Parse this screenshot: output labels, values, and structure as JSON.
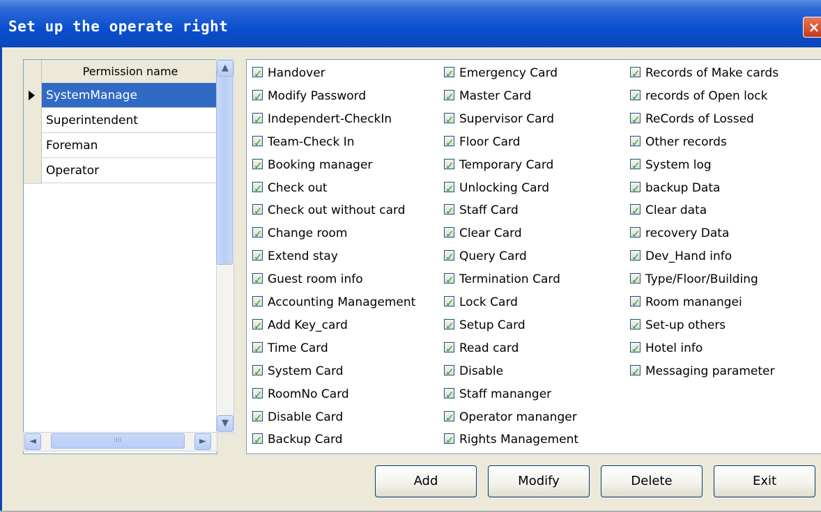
{
  "window": {
    "title": "Set up the operate right",
    "close_label": "×"
  },
  "grid": {
    "header": "Permission name",
    "rows": [
      "SystemManage",
      "Superintendent",
      "Foreman",
      "Operator"
    ],
    "selected_index": 0,
    "scroll_up_label": "▲",
    "scroll_down_label": "▼",
    "scroll_left_label": "◄",
    "scroll_right_label": "►",
    "hthumb_grip": "IIII"
  },
  "permissions": {
    "col1": [
      "Handover",
      "Modify Password",
      "Independert-CheckIn",
      "Team-Check In",
      "Booking manager",
      "Check out",
      "Check out without card",
      "Change room",
      "Extend stay",
      "Guest room info",
      "Accounting Management",
      "Add Key_card",
      "Time Card",
      "System Card",
      "RoomNo Card",
      "Disable Card",
      "Backup Card"
    ],
    "col2": [
      "Emergency Card",
      "Master Card",
      "Supervisor Card",
      "Floor Card",
      "Temporary Card",
      "Unlocking Card",
      "Staff Card",
      "Clear Card",
      "Query Card",
      "Termination Card",
      "Lock Card",
      "Setup Card",
      "Read card",
      "Disable",
      "Staff mananger",
      "Operator mananger",
      "Rights Management"
    ],
    "col3": [
      "Records of Make cards",
      "records of Open lock",
      "ReCords of Lossed",
      "Other records",
      "System log",
      "backup Data",
      "Clear data",
      "recovery Data",
      "Dev_Hand info",
      "Type/Floor/Building",
      "Room manangei",
      "Set-up others",
      "Hotel info",
      "Messaging parameter"
    ],
    "all_checked": true
  },
  "buttons": {
    "add": "Add",
    "modify": "Modify",
    "delete": "Delete",
    "exit": "Exit"
  }
}
